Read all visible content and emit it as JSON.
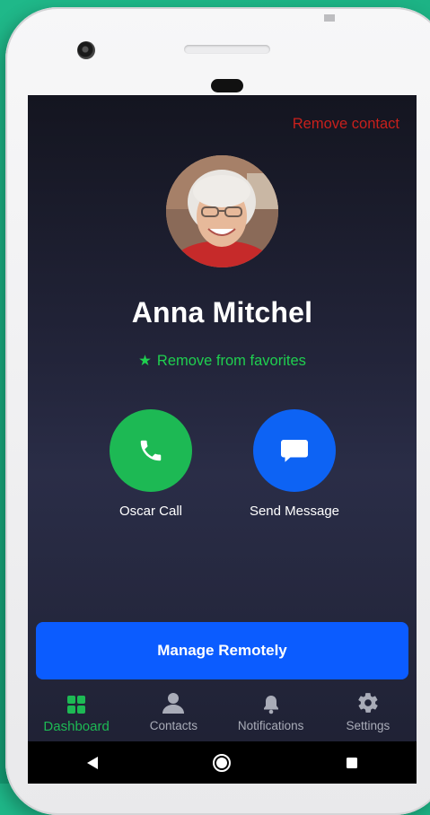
{
  "header": {
    "remove_contact_label": "Remove contact"
  },
  "contact": {
    "name": "Anna Mitchel",
    "favorite_label": "Remove from favorites",
    "favorite_icon": "★"
  },
  "actions": [
    {
      "label": "Oscar Call",
      "icon": "phone-icon",
      "color": "#1db954"
    },
    {
      "label": "Send Message",
      "icon": "message-icon",
      "color": "#0d63f4"
    }
  ],
  "manage_button_label": "Manage Remotely",
  "tabs": [
    {
      "label": "Dashboard",
      "icon": "dashboard-icon",
      "active": true
    },
    {
      "label": "Contacts",
      "icon": "contacts-icon",
      "active": false
    },
    {
      "label": "Notifications",
      "icon": "bell-icon",
      "active": false
    },
    {
      "label": "Settings",
      "icon": "gear-icon",
      "active": false
    }
  ],
  "system_nav": [
    "back-icon",
    "home-icon",
    "recents-icon"
  ],
  "colors": {
    "accent_green": "#1db954",
    "accent_blue": "#0b5cff",
    "danger_red": "#c8201c",
    "background_teal": "#1fb889"
  }
}
